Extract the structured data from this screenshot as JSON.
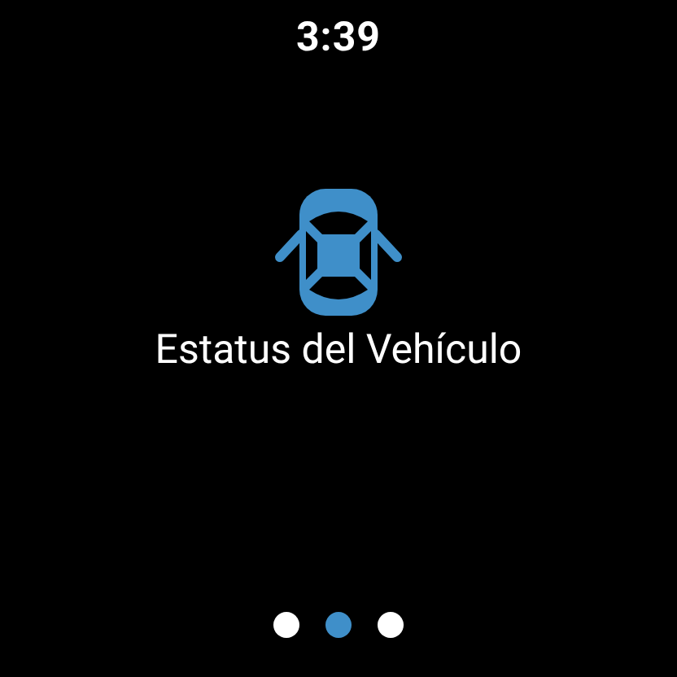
{
  "status_bar": {
    "time": "3:39"
  },
  "card": {
    "title": "Estatus del Vehículo"
  },
  "page_dots": [
    {
      "selected": false
    },
    {
      "selected": true
    },
    {
      "selected": false
    }
  ]
}
